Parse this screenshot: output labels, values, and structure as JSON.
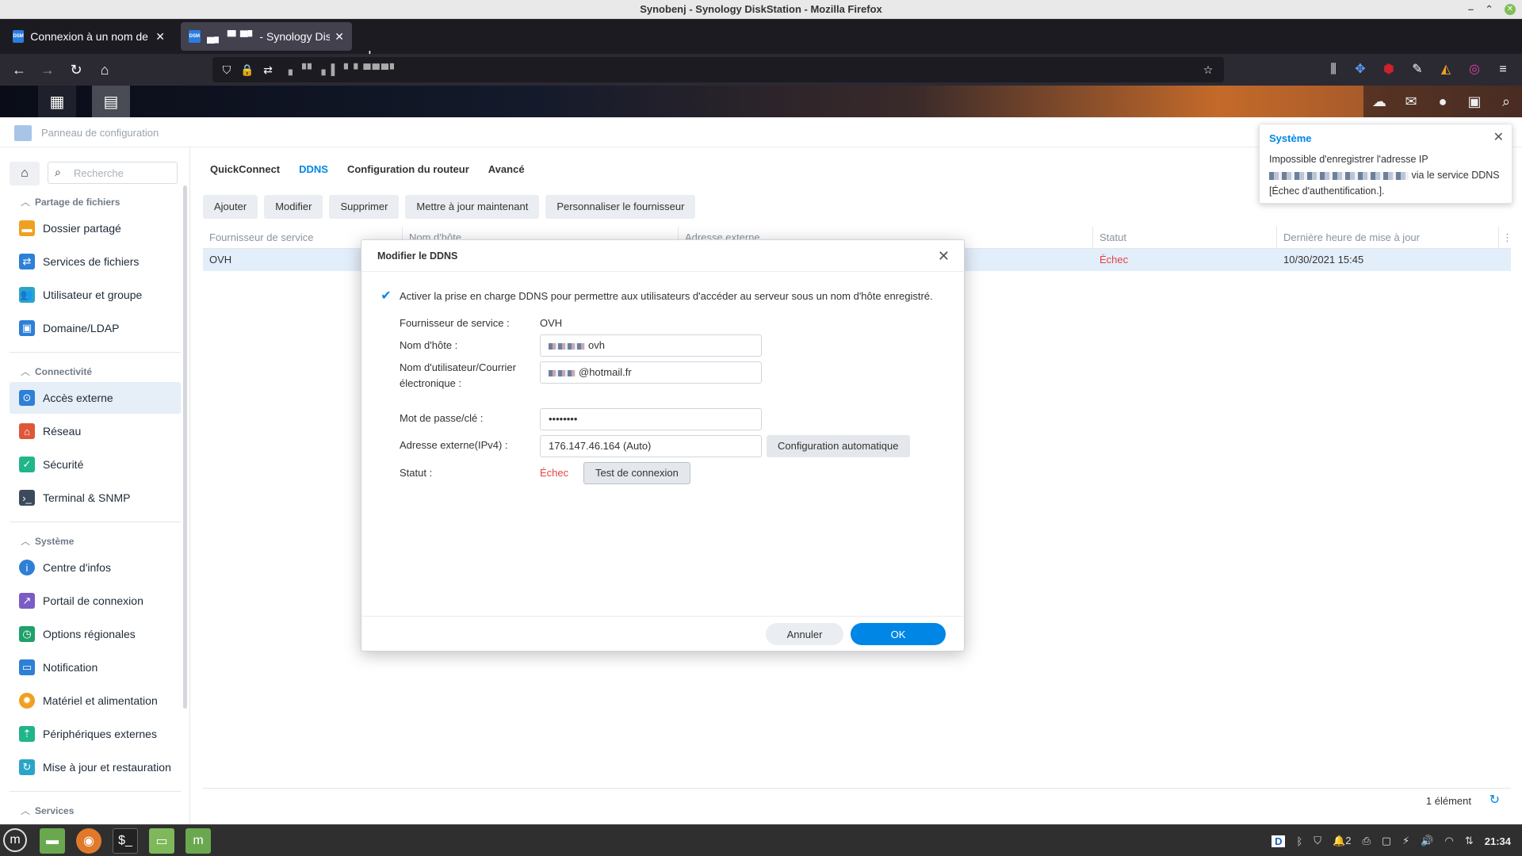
{
  "os": {
    "window_title": "Synobenj - Synology DiskStation - Mozilla Firefox",
    "minimize": "–",
    "maximize": "⌃",
    "close": "✕"
  },
  "browser": {
    "tabs": [
      {
        "favicon": "DSM",
        "title": "Connexion à un nom de dom",
        "active": false
      },
      {
        "favicon": "DSM",
        "title": "▄▖▝▘▀▘ - Synology DiskSta",
        "active": true
      }
    ],
    "new_tab": "+",
    "url_text": "▖▝▘ ▖▌▝ ▘▀▀▀▘"
  },
  "dsm": {
    "window_title": "Panneau de configuration"
  },
  "sidebar": {
    "search_placeholder": "Recherche",
    "sections": [
      {
        "title": "Partage de fichiers",
        "items": [
          "Dossier partagé",
          "Services de fichiers",
          "Utilisateur et groupe",
          "Domaine/LDAP"
        ]
      },
      {
        "title": "Connectivité",
        "items": [
          "Accès externe",
          "Réseau",
          "Sécurité",
          "Terminal & SNMP"
        ]
      },
      {
        "title": "Système",
        "items": [
          "Centre d'infos",
          "Portail de connexion",
          "Options régionales",
          "Notification",
          "Matériel et alimentation",
          "Périphériques externes",
          "Mise à jour et restauration"
        ]
      },
      {
        "title": "Services",
        "items": []
      }
    ],
    "active_item": "Accès externe",
    "icon_colors": {
      "folder": "#f0a020",
      "files": "#2e7fd6",
      "users": "#2aa5c8",
      "domain": "#2e7fd6",
      "external": "#2e7fd6",
      "network": "#e0563a",
      "security": "#20b58a",
      "terminal": "#3c4a5c",
      "info": "#2e7fd6",
      "portal": "#7b5cc4",
      "regional": "#20a06a",
      "notification": "#2e7fd6",
      "hardware": "#f0a020",
      "external_devices": "#20b58a",
      "update": "#2aa5c8"
    }
  },
  "main": {
    "tabs": [
      "QuickConnect",
      "DDNS",
      "Configuration du routeur",
      "Avancé"
    ],
    "active_tab": "DDNS",
    "toolbar": [
      "Ajouter",
      "Modifier",
      "Supprimer",
      "Mettre à jour maintenant",
      "Personnaliser le fournisseur"
    ],
    "columns": [
      "Fournisseur de service",
      "Nom d'hôte",
      "Adresse externe",
      "Statut",
      "Dernière heure de mise à jour"
    ],
    "rows": [
      {
        "provider": "OVH",
        "hostname": "",
        "external": "",
        "status": "Échec",
        "updated": "10/30/2021 15:45"
      }
    ],
    "footer_count": "1 élément"
  },
  "notification": {
    "title": "Système",
    "text_before": "Impossible d'enregistrer l'adresse IP",
    "text_after": "via le service DDNS [Échec d'authentification.]."
  },
  "modal": {
    "title": "Modifier le DDNS",
    "enable_label": "Activer la prise en charge DDNS pour permettre aux utilisateurs d'accéder au serveur sous un nom d'hôte enregistré.",
    "enable_checked": true,
    "fields": {
      "provider_label": "Fournisseur de service :",
      "provider_value": "OVH",
      "hostname_label": "Nom d'hôte :",
      "hostname_suffix": "ovh",
      "username_label": "Nom d'utilisateur/Courrier électronique :",
      "username_suffix": "@hotmail.fr",
      "password_label": "Mot de passe/clé :",
      "password_value": "••••••••",
      "ipv4_label": "Adresse externe(IPv4) :",
      "ipv4_value": "176.147.46.164 (Auto)",
      "status_label": "Statut :",
      "status_value": "Échec"
    },
    "auto_config_button": "Configuration automatique",
    "test_button": "Test de connexion",
    "cancel_button": "Annuler",
    "ok_button": "OK"
  },
  "taskbar": {
    "tray_workspace": "2",
    "clock": "21:34"
  },
  "colors": {
    "accent": "#0086e5",
    "error": "#e64040",
    "selected_row": "#e3eefb"
  }
}
